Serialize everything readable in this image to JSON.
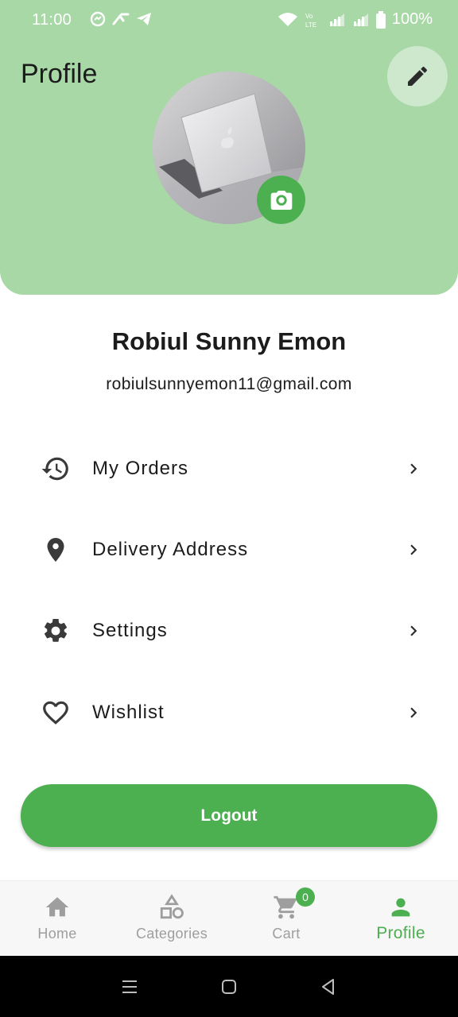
{
  "status_bar": {
    "time": "11:00",
    "battery": "100%",
    "icons": [
      "messenger-icon",
      "carrier-icon",
      "telegram-icon",
      "wifi-icon",
      "volte-icon",
      "signal-icon",
      "signal-icon",
      "battery-icon"
    ]
  },
  "header": {
    "title": "Profile",
    "edit_icon": "pencil-icon",
    "camera_icon": "camera-icon"
  },
  "user": {
    "name": "Robiul Sunny Emon",
    "email": "robiulsunnyemon11@gmail.com"
  },
  "menu": [
    {
      "label": "My Orders",
      "icon": "history-icon"
    },
    {
      "label": "Delivery Address",
      "icon": "location-pin-icon"
    },
    {
      "label": "Settings",
      "icon": "gear-icon"
    },
    {
      "label": "Wishlist",
      "icon": "heart-icon"
    }
  ],
  "logout_label": "Logout",
  "bottom_nav": {
    "items": [
      {
        "label": "Home",
        "icon": "home-icon"
      },
      {
        "label": "Categories",
        "icon": "categories-icon"
      },
      {
        "label": "Cart",
        "icon": "cart-icon",
        "badge": "0"
      },
      {
        "label": "Profile",
        "icon": "person-icon",
        "active": true
      }
    ]
  },
  "colors": {
    "accent": "#4caf50",
    "header_bg": "#a7d8a6",
    "inactive": "#9e9e9e"
  }
}
